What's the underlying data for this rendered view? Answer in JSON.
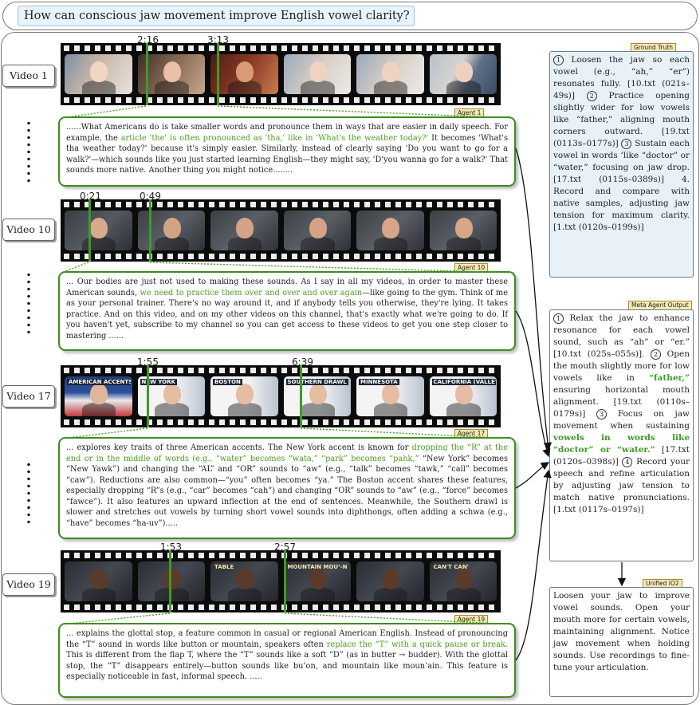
{
  "question": "How can conscious jaw movement improve English vowel clarity?",
  "videos": [
    {
      "label": "Video 1",
      "timestamps": [
        "2:16",
        "3:13"
      ],
      "frames": [
        {
          "bg": "linear-gradient(120deg,#7b8fa6,#c9b8a8 45%,#e7e3df)",
          "fig": "#f2d6c4"
        },
        {
          "bg": "linear-gradient(120deg,#3a2f2a,#8c6b55 50%,#c7a78f)",
          "fig": "#e8c0a8"
        },
        {
          "bg": "linear-gradient(120deg,#4a1c16,#8a3a26 50%,#c97c52)",
          "fig": "#d99a78"
        },
        {
          "bg": "linear-gradient(120deg,#9aa9bb,#d7cec6 50%,#eeeae6)",
          "fig": "#f0d2c0"
        },
        {
          "bg": "linear-gradient(120deg,#9aa9bb,#d8cfc7 50%,#ecebe8)",
          "fig": "#f0d2c0"
        },
        {
          "bg": "linear-gradient(120deg,#b7c0cc,#d6d3d0 40%,#5f6f86 62%,#394a63)",
          "fig": "#efd0be"
        }
      ],
      "agent_tag": "Agent 1",
      "agent_text": [
        {
          "t": "......What Americans do is take smaller words and pronounce them in ways that are easier in daily speech. For example, the ",
          "hl": false
        },
        {
          "t": "article 'the' is often pronounced as 'tha,' like in 'What's the weather today?'",
          "hl": true
        },
        {
          "t": " It becomes 'What's tha weather today?' because it's simply easier. Similarly, instead of clearly saying 'Do you want to go for a walk?'—which sounds like you just started learning English—they might say, 'D'you wanna go for a walk?' That sounds more native. Another thing you might notice........",
          "hl": false
        }
      ]
    },
    {
      "label": "Video 10",
      "timestamps": [
        "0:21",
        "0:49"
      ],
      "frames": [
        {
          "bg": "linear-gradient(135deg,#3a3d43,#555a62 50%,#2d2f33)",
          "fig": "#d8a98c"
        },
        {
          "bg": "linear-gradient(135deg,#3c3f45,#5a5e66 50%,#2e3035)",
          "fig": "#d4a386"
        },
        {
          "bg": "linear-gradient(135deg,#3c3f45,#5a5e66 50%,#2e3035)",
          "fig": "#d4a386"
        },
        {
          "bg": "linear-gradient(135deg,#3c3f45,#5a5e66 50%,#2e3035)",
          "fig": "#d4a386"
        },
        {
          "bg": "linear-gradient(135deg,#3c3f45,#5a5e66 50%,#2e3035)",
          "fig": "#d7a588"
        },
        {
          "bg": "linear-gradient(135deg,#3c3f45,#5a5e66 50%,#2e3035)",
          "fig": "#d7a588"
        }
      ],
      "agent_tag": "Agent 10",
      "agent_text": [
        {
          "t": "... Our bodies are just not used to making these sounds. As I say in all my videos, in order to master these American sounds, ",
          "hl": false
        },
        {
          "t": "we need to practice them over and over and over again",
          "hl": true
        },
        {
          "t": "—like going to the gym. Think of me as your personal trainer. There's no way around it, and if anybody tells you otherwise, they're lying. It takes practice. And on this video, and on my other videos on this channel, that's exactly what we're going to do. If you haven't yet, subscribe to my channel so you can get access to these videos to get you one step closer to mastering ......",
          "hl": false
        }
      ]
    },
    {
      "label": "Video 17",
      "timestamps": [
        "1:55",
        "6:39"
      ],
      "frames": [
        {
          "bg": "linear-gradient(180deg,#1f3f86,#2d4f9a 40%,#e9e9ea 60%,#c23a3a)",
          "fig": "#e2b59a"
        },
        {
          "bg": "linear-gradient(90deg,#f4f4f4 55%,#b9c3cf)",
          "fig": "#e6bca2"
        },
        {
          "bg": "linear-gradient(90deg,#f4f4f4 55%,#b9c3cf)",
          "fig": "#e6bca2"
        },
        {
          "bg": "linear-gradient(90deg,#f4f4f4 55%,#b9c3cf)",
          "fig": "#e6bca2"
        },
        {
          "bg": "linear-gradient(90deg,#f4f4f4 55%,#b9c3cf)",
          "fig": "#e6bca2"
        },
        {
          "bg": "linear-gradient(90deg,#f4f4f4 55%,#b9c3cf)",
          "fig": "#e6bca2"
        }
      ],
      "frame_captions": [
        "AMERICAN ACCENTS",
        "NEW YORK",
        "BOSTON",
        "SOUTHERN DRAWL",
        "MINNESOTA",
        "CALIFORNIA (VALLEY)"
      ],
      "agent_tag": "Agent 17",
      "agent_text": [
        {
          "t": "...  explores key traits of three American accents. The New York accent is known for ",
          "hl": false
        },
        {
          "t": "dropping the “R” at the end or in the middle of words (e.g., “water” becomes “wata,” “park” becomes “pahk,”",
          "hl": true
        },
        {
          "t": " “New York” becomes “New Yawk”) and changing the “AL” and “OR” sounds to “aw” (e.g., “talk” becomes “tawk,” “call” becomes “caw”). Reductions are also common—“you” often becomes “ya.” The Boston accent shares these features, especially dropping “R”s (e.g., “car” becomes “cah”) and changing “OR” sounds to “aw” (e.g., “force” becomes “fawce”). It also features an upward inflection at the end of sentences. Meanwhile, the Southern drawl is slower and stretches out vowels by turning short vowel sounds into diphthongs, often adding a schwa (e.g., “have” becomes “ha-uv”).....",
          "hl": false
        }
      ]
    },
    {
      "label": "Video 19",
      "timestamps": [
        "1:53",
        "2:57"
      ],
      "frames": [
        {
          "bg": "linear-gradient(135deg,#2a2d33,#444851 50%,#23252a)",
          "fig": "#5a3a2a"
        },
        {
          "bg": "linear-gradient(135deg,#2a2d33,#444851 50%,#23252a)",
          "fig": "#5a3a2a"
        },
        {
          "bg": "linear-gradient(135deg,#2a2d33,#444851 50%,#23252a)",
          "fig": "#5a3a2a"
        },
        {
          "bg": "linear-gradient(135deg,#2a2d33,#444851 50%,#23252a)",
          "fig": "#5a3a2a"
        },
        {
          "bg": "linear-gradient(135deg,#2a2d33,#444851 50%,#23252a)",
          "fig": "#5a3a2a"
        },
        {
          "bg": "linear-gradient(135deg,#2a2d33,#444851 50%,#23252a)",
          "fig": "#5a3a2a"
        }
      ],
      "frame_captions": [
        "",
        "",
        "TABLE",
        "MOUNTAIN MOU’-N",
        "",
        "CAN'T CAN'"
      ],
      "agent_tag": "Agent 19",
      "agent_text": [
        {
          "t": "...  explains the glottal stop, a feature common in casual or regional American English. Instead of pronouncing the “T” sound in words like button or mountain, speakers often ",
          "hl": false
        },
        {
          "t": "replace the “T” with a quick pause or break.",
          "hl": true
        },
        {
          "t": " This is different from the flap T, where the “T” sounds like a soft “D” (as in butter → budder). With the glottal stop, the “T” disappears entirely—button sounds like bu’on, and mountain like moun’ain. This feature is especially noticeable in fast, informal speech. .....",
          "hl": false
        }
      ]
    }
  ],
  "ground_truth": {
    "tag": "Ground Truth",
    "parts": [
      {
        "t": "①",
        "k": "num"
      },
      {
        "t": " Loosen the jaw so each vowel (e.g., “ah,” “er”) resonates fully. [10.txt (021s–49s)] ",
        "k": "txt"
      },
      {
        "t": "②",
        "k": "num"
      },
      {
        "t": " Practice opening slightly wider for low vowels like “father,” aligning mouth corners outward. [19.txt (0113s–0177s)] ",
        "k": "txt"
      },
      {
        "t": "③",
        "k": "num"
      },
      {
        "t": " Sustain each vowel in words ‘like “doctor” or “water,” focusing on jaw drop. [17.txt (0115s–0389s)] 4. Record and compare with native samples, adjusting jaw tension for maximum clarity.[1.txt (0120s–0199s)]",
        "k": "txt"
      }
    ]
  },
  "meta_agent": {
    "tag": "Meta Agent Output",
    "parts": [
      {
        "t": "①",
        "k": "num"
      },
      {
        "t": " Relax the jaw to enhance resonance for each vowel sound, such as “ah” or “er.” [10.txt (025s–055s)]. ",
        "k": "txt"
      },
      {
        "t": "②",
        "k": "num"
      },
      {
        "t": " Open the mouth slightly more for low vowels like in ",
        "k": "txt"
      },
      {
        "t": "“father,”",
        "k": "hl"
      },
      {
        "t": " ensuring horizontal mouth alignment. [19.txt (0110s–0179s)] ",
        "k": "txt"
      },
      {
        "t": "③",
        "k": "num"
      },
      {
        "t": " Focus on jaw movement when sustaining ",
        "k": "txt"
      },
      {
        "t": "vowels in words like “doctor” or “water.”",
        "k": "hl"
      },
      {
        "t": " [17.txt (0120s–0398s)] ",
        "k": "txt"
      },
      {
        "t": "④",
        "k": "num"
      },
      {
        "t": " Record your speech and refine articulation by adjusting jaw tension to match native pronunciations. [1.txt (0117s–0197s)]",
        "k": "txt"
      }
    ]
  },
  "unified": {
    "tag": "Unified IO2",
    "text": "Loosen your jaw to improve vowel sounds. Open your mouth more for certain vowels, maintaining alignment. Notice jaw movement when holding sounds. Use recordings to fine-tune your articulation."
  },
  "colors": {
    "highlight_green": "#4a9e20",
    "agent_border": "#3e8c1f",
    "tag_fill": "#f8e9b4",
    "ground_truth_fill": "#e8f1f8",
    "question_fill": "#e9f3fb"
  }
}
